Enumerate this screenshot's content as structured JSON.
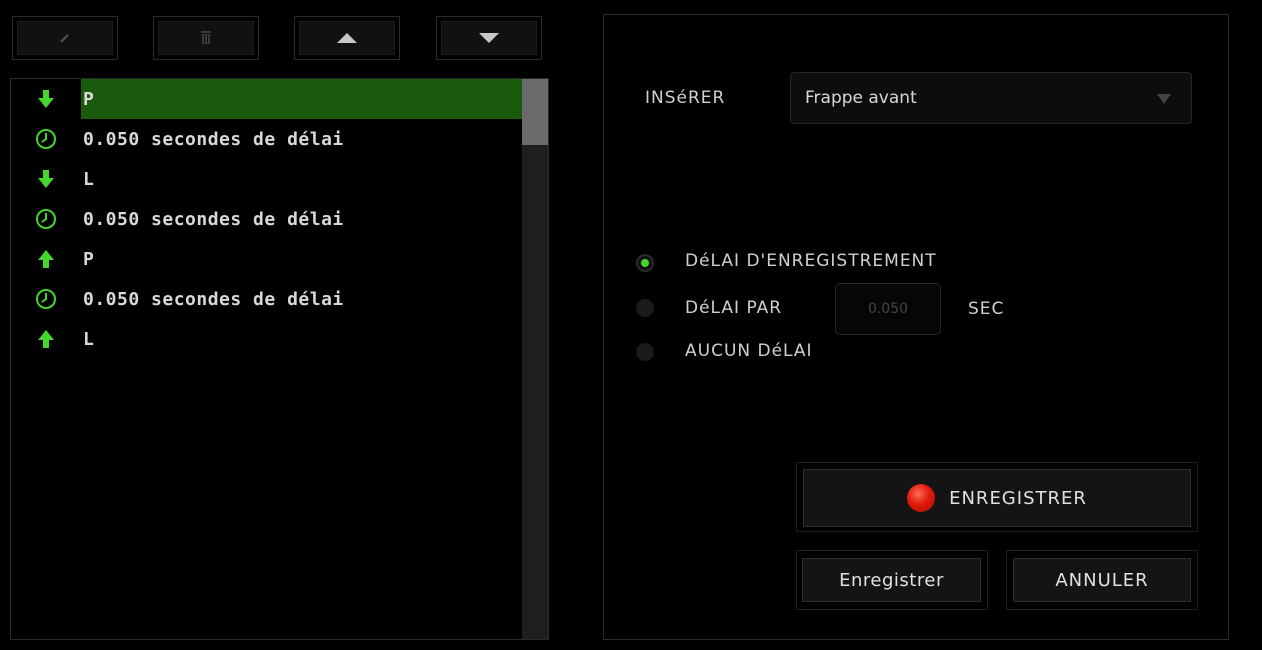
{
  "toolbar": {
    "buttons": [
      {
        "name": "edit",
        "icon": "pencil-icon"
      },
      {
        "name": "delete",
        "icon": "trash-icon"
      },
      {
        "name": "move-up",
        "icon": "triangle-up-icon"
      },
      {
        "name": "move-down",
        "icon": "triangle-down-icon"
      }
    ]
  },
  "macro_list": {
    "items": [
      {
        "type": "key-down",
        "icon": "arrow-down-icon",
        "text": "P",
        "selected": true
      },
      {
        "type": "delay",
        "icon": "clock-icon",
        "text": "0.050 secondes de délai"
      },
      {
        "type": "key-down",
        "icon": "arrow-down-icon",
        "text": "L"
      },
      {
        "type": "delay",
        "icon": "clock-icon",
        "text": "0.050 secondes de délai"
      },
      {
        "type": "key-up",
        "icon": "arrow-up-icon",
        "text": "P"
      },
      {
        "type": "delay",
        "icon": "clock-icon",
        "text": "0.050 secondes de délai"
      },
      {
        "type": "key-up",
        "icon": "arrow-up-icon",
        "text": "L"
      }
    ]
  },
  "insert": {
    "label": "INSéRER",
    "selected": "Frappe avant"
  },
  "delay_options": {
    "record_delay": "DéLAI D'ENREGISTREMENT",
    "delay_by": "DéLAI PAR",
    "delay_value": "0.050",
    "unit": "SEC",
    "no_delay": "AUCUN DéLAI",
    "selected": "record_delay"
  },
  "actions": {
    "record": "ENREGISTRER",
    "save": "Enregistrer",
    "cancel": "ANNULER"
  },
  "colors": {
    "accent": "#44d62c",
    "selection": "#1a5a0c",
    "record": "#e01a0a"
  }
}
